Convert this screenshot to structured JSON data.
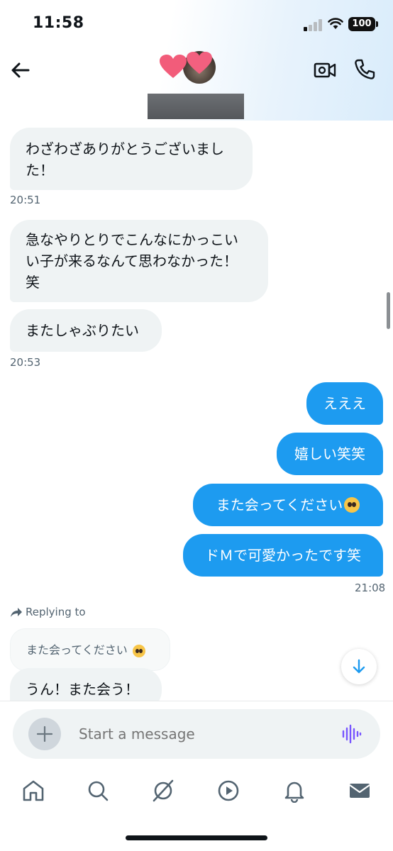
{
  "status_bar": {
    "time": "11:58",
    "battery": "100"
  },
  "header": {
    "back_icon": "arrow-left-icon",
    "video_icon": "video-camera-icon",
    "call_icon": "phone-icon"
  },
  "messages": [
    {
      "side": "in",
      "text": "わざわざありがとうございました！"
    },
    {
      "side": "in",
      "timestamp": "20:51"
    },
    {
      "side": "in",
      "text": "急なやりとりでこんなにかっこいい子が来るなんて思わなかった！笑"
    },
    {
      "side": "in",
      "text": "またしゃぶりたい"
    },
    {
      "side": "in",
      "timestamp": "20:53"
    },
    {
      "side": "out",
      "text": "えええ"
    },
    {
      "side": "out",
      "text": "嬉しい笑笑"
    },
    {
      "side": "out",
      "text": "また会ってください",
      "emoji": "pleading-face"
    },
    {
      "side": "out",
      "text": "ドＭで可愛かったです笑"
    },
    {
      "side": "out",
      "timestamp": "21:08"
    },
    {
      "side": "in",
      "text": "うん！また会う！"
    }
  ],
  "bubbles": {
    "m1_line1": "わざわざありがとうございまし",
    "m1_line2": "た！",
    "ts1": "20:51",
    "m2_line1": "急なやりとりでこんなにかっこい",
    "m2_line2": "い子が来るなんて思わなかった！",
    "m2_line3": "笑",
    "m3": "またしゃぶりたい",
    "ts2": "20:53",
    "o1": "えええ",
    "o2": "嬉しい笑笑",
    "o3": "また会ってください",
    "o4": "ドＭで可愛かったです笑",
    "ts3": "21:08",
    "m4": "うん！また会う！"
  },
  "reply": {
    "label": "Replying to",
    "quoted": "また会ってください"
  },
  "composer": {
    "placeholder": "Start a message"
  },
  "nav": [
    "home-icon",
    "search-icon",
    "grok-icon",
    "video-icon",
    "bell-icon",
    "mail-icon"
  ],
  "colors": {
    "accent": "#1d9bf0",
    "incoming_bg": "#eff3f4",
    "voice_icon": "#7856ff"
  }
}
